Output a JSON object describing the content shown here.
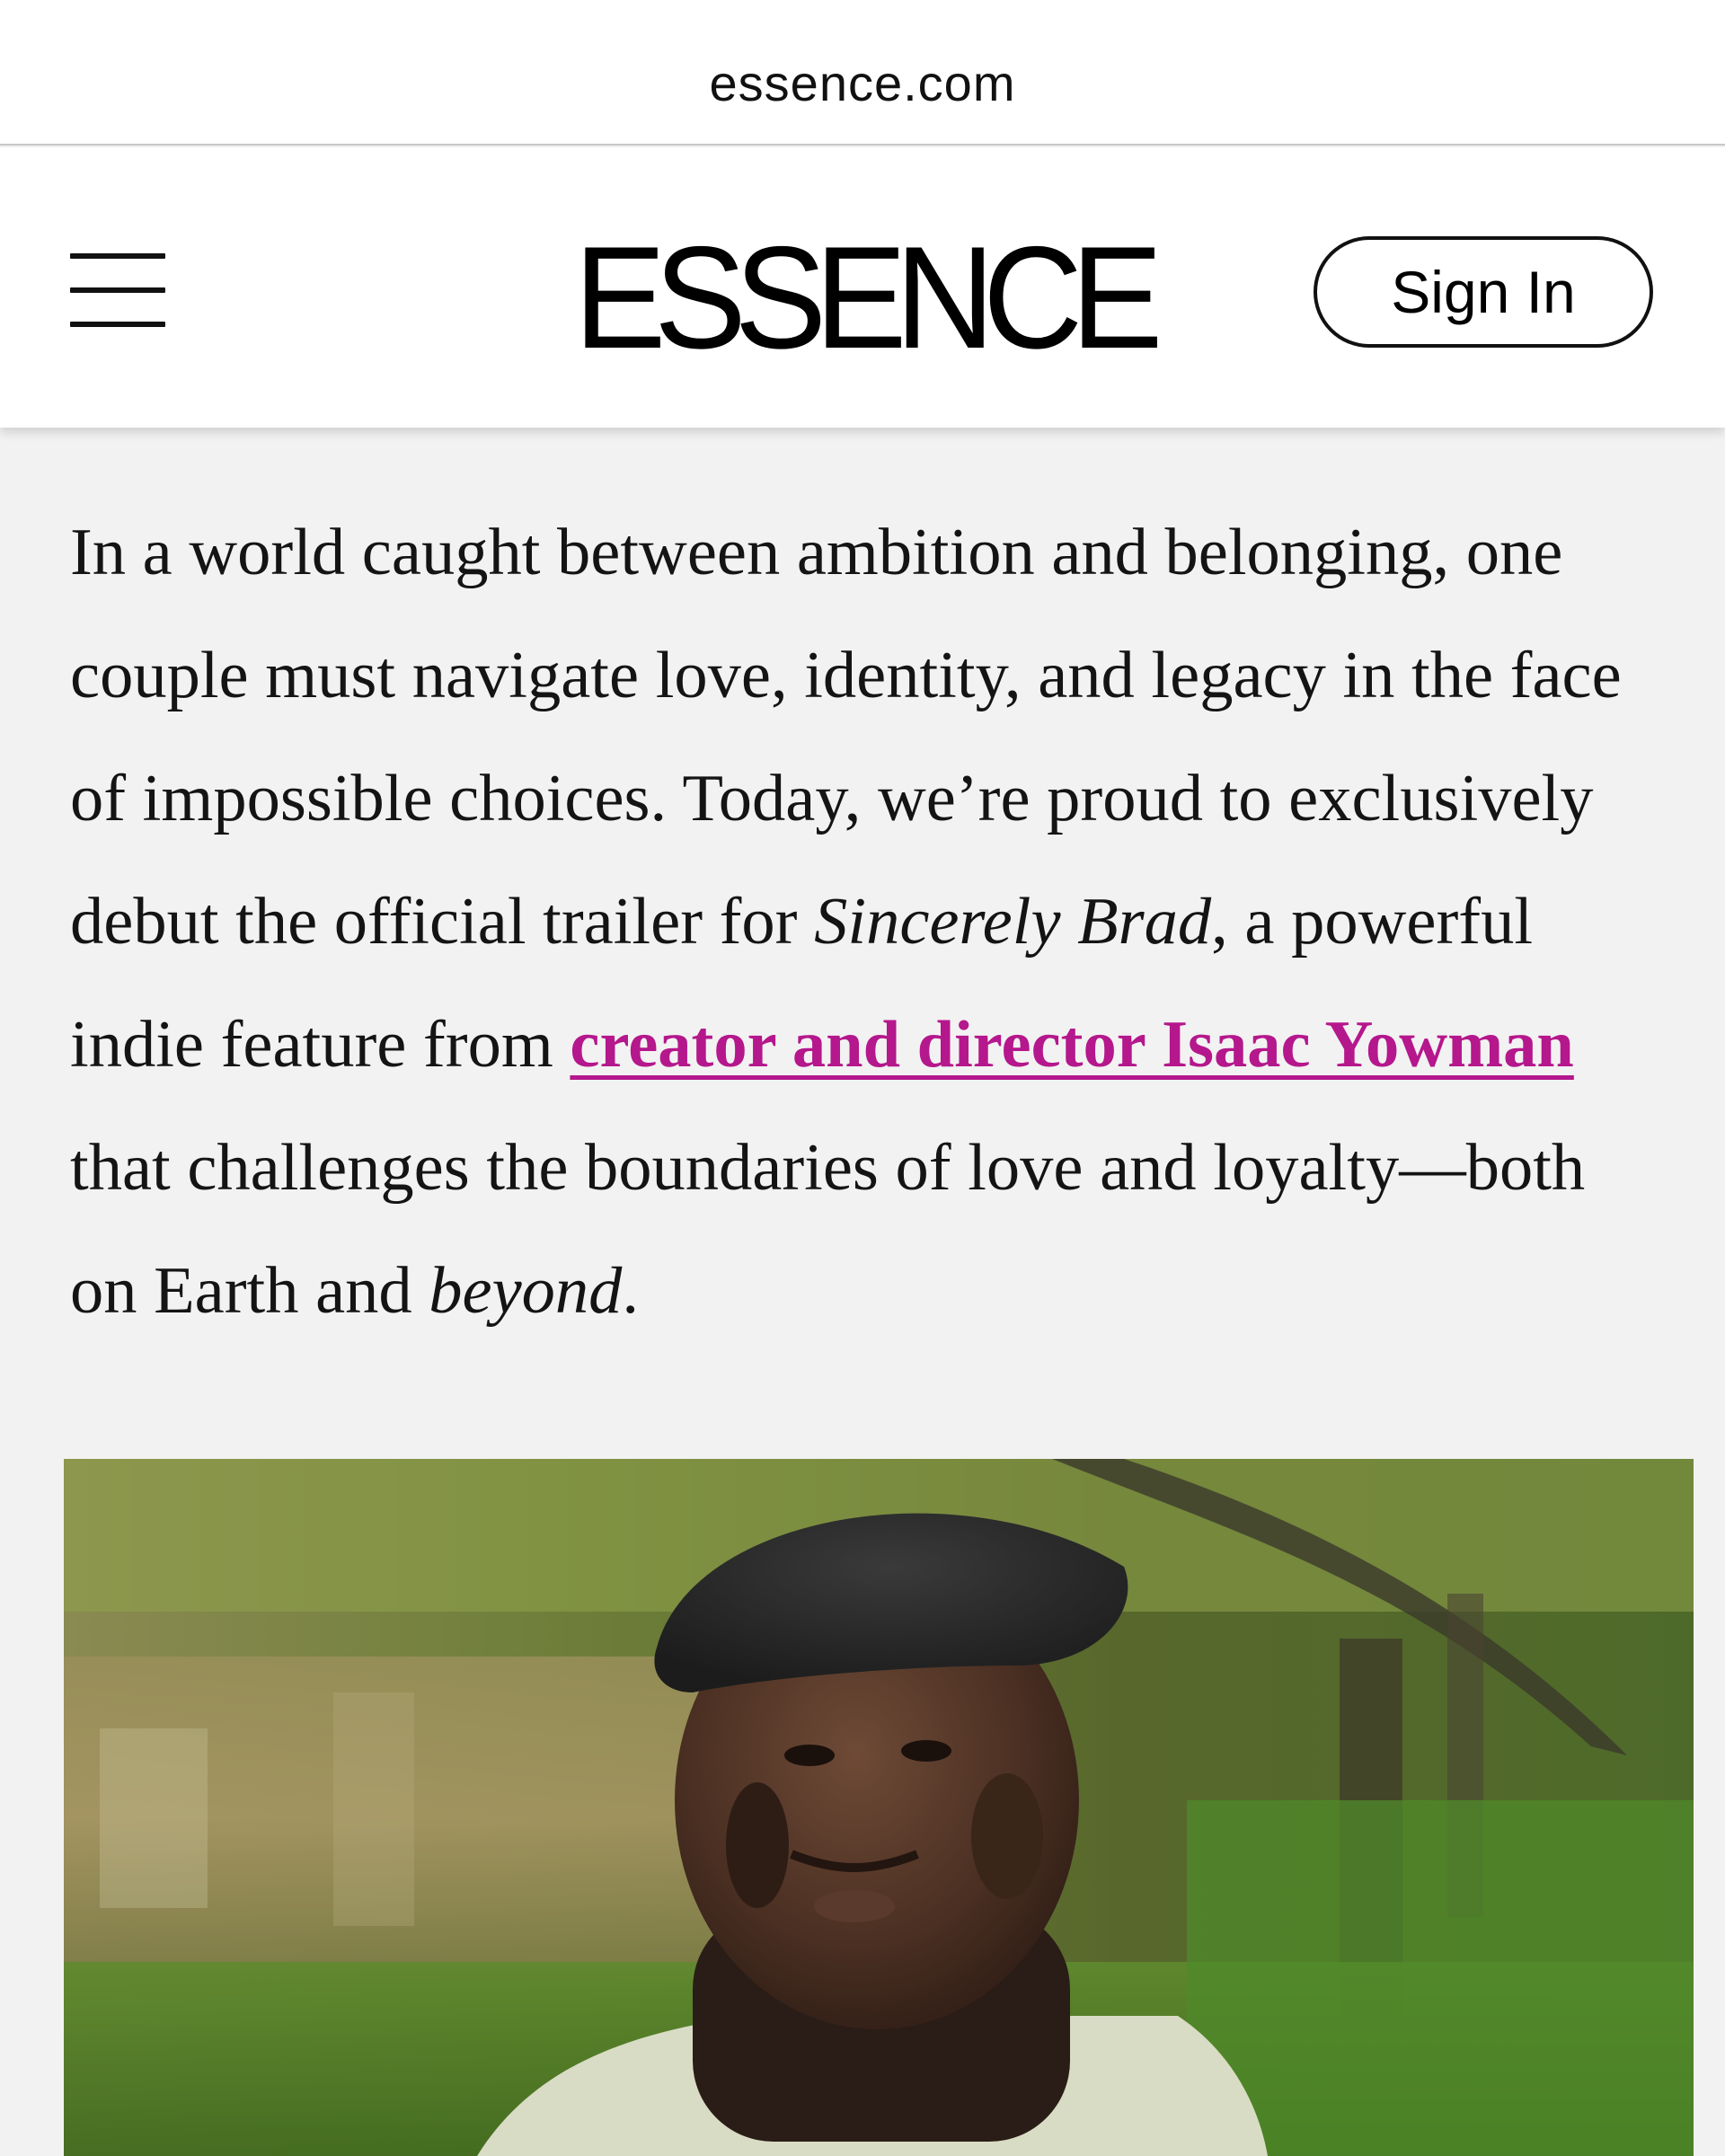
{
  "browser": {
    "url": "essence.com"
  },
  "header": {
    "logo": "ESSENCE",
    "sign_in_label": "Sign In"
  },
  "article": {
    "p1_a": "In a world caught between ambition and belonging, one couple must navigate love, identity, and legacy in the face of impossible choices. Today, we’re proud to exclusively debut the official trailer for ",
    "p1_title": "Sincerely Brad",
    "p1_b": ", a powerful indie feature from ",
    "p1_link": "creator and director Isaac Yowman",
    "p1_c": " that challenges the boundaries of love and loyalty—both on Earth and ",
    "p1_em": "beyond",
    "p1_d": "."
  },
  "colors": {
    "link": "#b5178c",
    "page_bg": "#f2f2f2",
    "header_bg": "#ffffff"
  },
  "icons": {
    "menu": "hamburger-menu-icon"
  }
}
